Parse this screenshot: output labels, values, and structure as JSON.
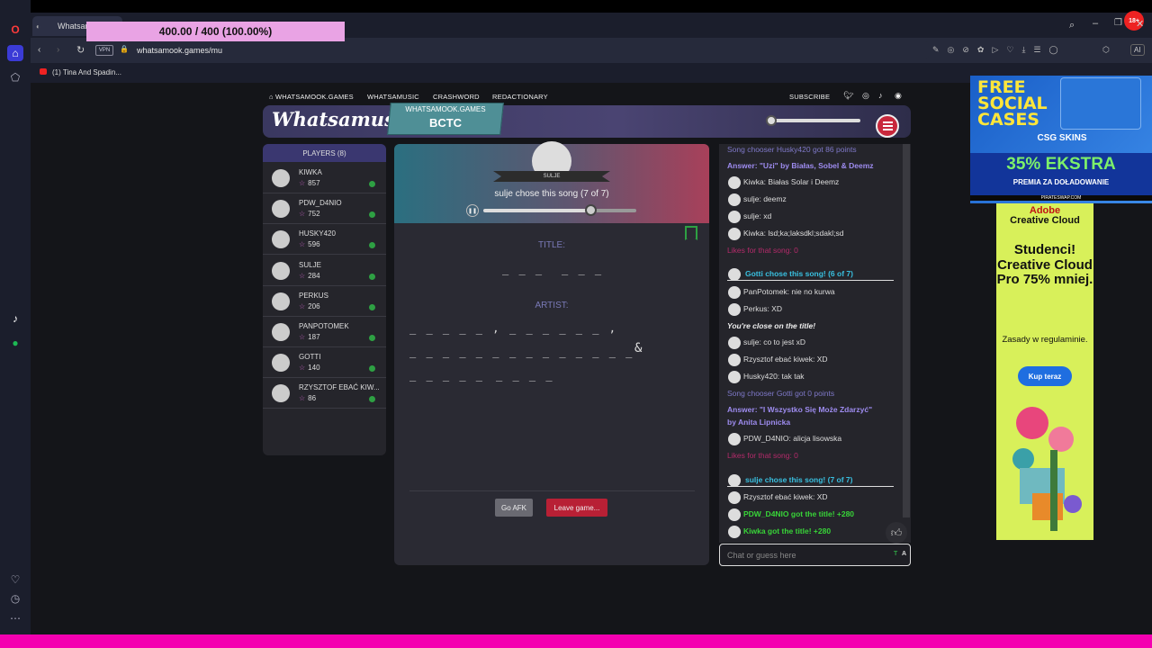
{
  "progress_overlay": "400.00 / 400 (100.00%)",
  "browser": {
    "tab_title": "Whatsam",
    "vpn_label": "VPN",
    "url": "whatsamook.games/mu",
    "bookmark": "(1) Tina And Spadin...",
    "age_badge": "18+",
    "ai_label": "AI"
  },
  "site_nav": {
    "home": "WHATSAMOOK.GAMES",
    "music": "WHATSAMUSIC",
    "crashword": "CRASHWORD",
    "redactionary": "REDACTIONARY",
    "subscribe": "SUBSCRIBE"
  },
  "banner": {
    "logo": "Whatsamusic",
    "badge_site": "WHATSAMOOK.GAMES",
    "room_code": "BCTC"
  },
  "players": {
    "header": "PLAYERS (8)",
    "list": [
      {
        "name": "KIWKA",
        "score": "857"
      },
      {
        "name": "PDW_D4NIO",
        "score": "752"
      },
      {
        "name": "HUSKY420",
        "score": "596"
      },
      {
        "name": "SULJE",
        "score": "284"
      },
      {
        "name": "PERKUS",
        "score": "206"
      },
      {
        "name": "PANPOTOMEK",
        "score": "187"
      },
      {
        "name": "GOTTI",
        "score": "140"
      },
      {
        "name": "RZYSZTOF EBAĆ KIW...",
        "score": "86"
      }
    ]
  },
  "game": {
    "chooser_name": "SULJE",
    "chose_text": "sulje chose this song (7 of 7)",
    "song_progress": 0.7,
    "title_label": "TITLE:",
    "title_blanks": [
      "_ _ _",
      "_ _ _"
    ],
    "artist_label": "ARTIST:",
    "artist_line1a": "_ _ _ _ _ ,",
    "artist_line1b": "_ _ _ _ _ _ ,",
    "artist_line2a": "_ _ _ _ _ _",
    "artist_line2b": "_ _ _ _ _ _ _ _",
    "ampersand": "&",
    "artist_line3a": "_ _ _ _ _",
    "artist_line3b": "_ _ _ _",
    "afk_button": "Go AFK",
    "leave_button": "Leave game..."
  },
  "chat": {
    "messages": [
      {
        "type": "sys",
        "text": "Song chooser Husky420 got 86 points"
      },
      {
        "type": "ans",
        "text": "Answer: \"Uzi\" by Białas, Sobel & Deemz"
      },
      {
        "type": "msg",
        "text": "Kiwka: Białas Solar i Deemz"
      },
      {
        "type": "msg",
        "text": "sulje: deemz"
      },
      {
        "type": "msg",
        "text": "sulje: xd"
      },
      {
        "type": "msg",
        "text": "Kiwka: lsd;ka;laksdkl;sdakl;sd"
      },
      {
        "type": "likes",
        "text": "Likes for that song: 0"
      },
      {
        "type": "chose",
        "text": "Gotti chose this song! (6 of 7)"
      },
      {
        "type": "msg",
        "text": "PanPotomek: nie no kurwa"
      },
      {
        "type": "msg",
        "text": "Perkus: XD"
      },
      {
        "type": "close",
        "text": "You're close on the title!"
      },
      {
        "type": "msg",
        "text": "sulje: co to jest xD"
      },
      {
        "type": "msg",
        "text": "Rzysztof ebać kiwek: XD"
      },
      {
        "type": "msg",
        "text": "Husky420: tak tak"
      },
      {
        "type": "sys",
        "text": "Song chooser Gotti got 0 points"
      },
      {
        "type": "ans",
        "text": "Answer: \"I Wszystko Się Może Zdarzyć\""
      },
      {
        "type": "ans",
        "text": "by Anita Lipnicka"
      },
      {
        "type": "msg",
        "text": "PDW_D4NIO: alicja lisowska"
      },
      {
        "type": "likes",
        "text": "Likes for that song: 0"
      },
      {
        "type": "chose",
        "text": "sulje chose this song! (7 of 7)"
      },
      {
        "type": "msg",
        "text": "Rzysztof ebać kiwek: XD"
      },
      {
        "type": "got",
        "text": "PDW_D4NIO got the title! +280"
      },
      {
        "type": "got",
        "text": "Kiwka got the title! +280"
      }
    ],
    "input_placeholder": "Chat or guess here",
    "indicator_t": "T",
    "indicator_a": "A"
  },
  "ads": {
    "ad1_line1": "FREE",
    "ad1_line2": "SOCIAL",
    "ad1_line3": "CASES",
    "ad1_brand": "CSG SKINS",
    "ad1_offer": "35% EKSTRA",
    "ad1_sub": "PREMIA ZA DOŁADOWANIE",
    "ad1_footer": "PIRATESWAP.COM",
    "ad2_brand1": "Adobe",
    "ad2_brand2": "Creative Cloud",
    "ad2_headline": "Studenci! Creative Cloud Pro 75% mniej.",
    "ad2_rules": "Zasady w regulaminie.",
    "ad2_cta": "Kup teraz"
  }
}
